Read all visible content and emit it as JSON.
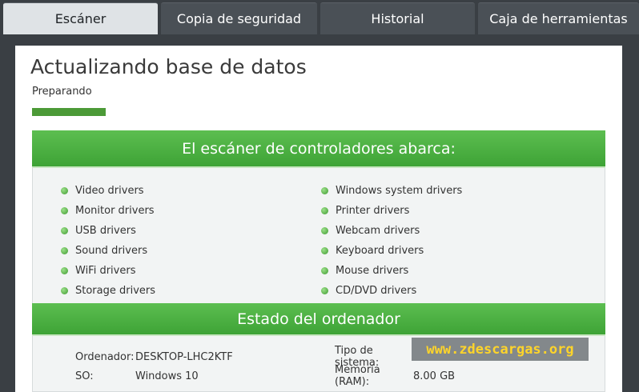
{
  "tabs": [
    {
      "label": "Escáner"
    },
    {
      "label": "Copia de seguridad"
    },
    {
      "label": "Historial"
    },
    {
      "label": "Caja de herramientas"
    }
  ],
  "main": {
    "title": "Actualizando base de datos",
    "status": "Preparando",
    "progress_percent": 35,
    "accent_color": "#4c9a37"
  },
  "scanner": {
    "heading": "El escáner de controladores abarca:",
    "left_items": [
      "Video drivers",
      "Monitor drivers",
      "USB drivers",
      "Sound drivers",
      "WiFi drivers",
      "Storage drivers"
    ],
    "right_items": [
      "Windows system drivers",
      "Printer drivers",
      "Webcam drivers",
      "Keyboard drivers",
      "Mouse drivers",
      "CD/DVD drivers"
    ]
  },
  "computer": {
    "heading": "Estado del ordenador",
    "computer_label": "Ordenador:",
    "computer_value": "DESKTOP-LHC2KTF",
    "os_label": "SO:",
    "os_value": "Windows 10",
    "systype_label": "Tipo de sistema:",
    "systype_value": "",
    "memory_label": "Memoria (RAM):",
    "memory_value": "8.00 GB"
  },
  "watermark": "www.zdescargas.org"
}
